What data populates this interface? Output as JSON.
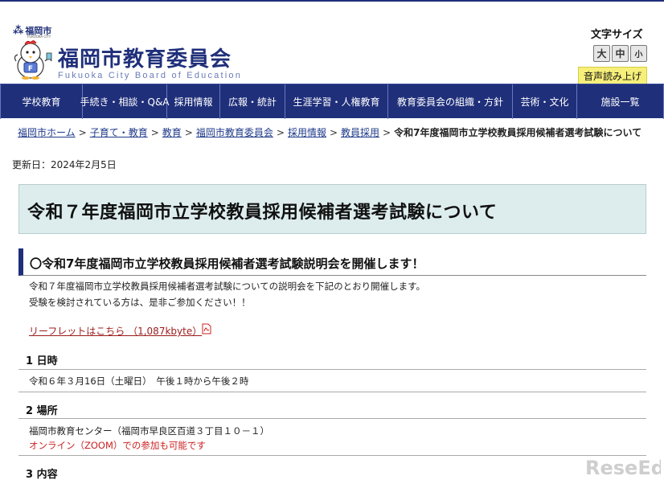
{
  "header": {
    "city_name": "福岡市",
    "city_sub": "FUKUOKA CITY",
    "title": "福岡市教育委員会",
    "subtitle": "Fukuoka City Board of Education",
    "mascot_letter": "F",
    "font_size_label": "文字サイズ",
    "font_sizes": [
      "大",
      "中",
      "小"
    ],
    "voice_button": "音声読み上げ"
  },
  "nav": {
    "items": [
      "学校教育",
      "手続き・相談・Q&A",
      "採用情報",
      "広報・統計",
      "生涯学習・人権教育",
      "教育委員会の組織・方針",
      "芸術・文化",
      "施設一覧"
    ]
  },
  "breadcrumb": {
    "links": [
      "福岡市ホーム",
      "子育て・教育",
      "教育",
      "福岡市教育委員会",
      "採用情報",
      "教員採用"
    ],
    "current": "令和7年度福岡市立学校教員採用候補者選考試験について"
  },
  "updated": "更新日：2024年2月5日",
  "page_title": "令和７年度福岡市立学校教員採用候補者選考試験について",
  "section": {
    "heading": "〇令和7年度福岡市立学校教員採用候補者選考試験説明会を開催します！",
    "intro1": "令和７年度福岡市立学校教員採用候補者選考試験についての説明会を下記のとおり開催します。",
    "intro2": "受験を検討されている方は、是非ご参加ください！！",
    "leaflet_link": "リーフレットはこちら （1,087kbyte）"
  },
  "items": [
    {
      "heading": "1 日時",
      "lines": [
        "令和６年３月16日（土曜日）　午後１時から午後２時"
      ]
    },
    {
      "heading": "2 場所",
      "lines": [
        "福岡市教育センター（福岡市早良区百道３丁目１０－１）"
      ],
      "note": "オンライン（ZOOM）での参加も可能です"
    },
    {
      "heading": "3 内容"
    }
  ],
  "watermark": "ReseEd",
  "colors": {
    "navy": "#1f2f7a",
    "link": "#1f3a8a",
    "red": "#cc2222",
    "title_bg": "#ddeded",
    "voice_bg": "#f6ef7a"
  }
}
